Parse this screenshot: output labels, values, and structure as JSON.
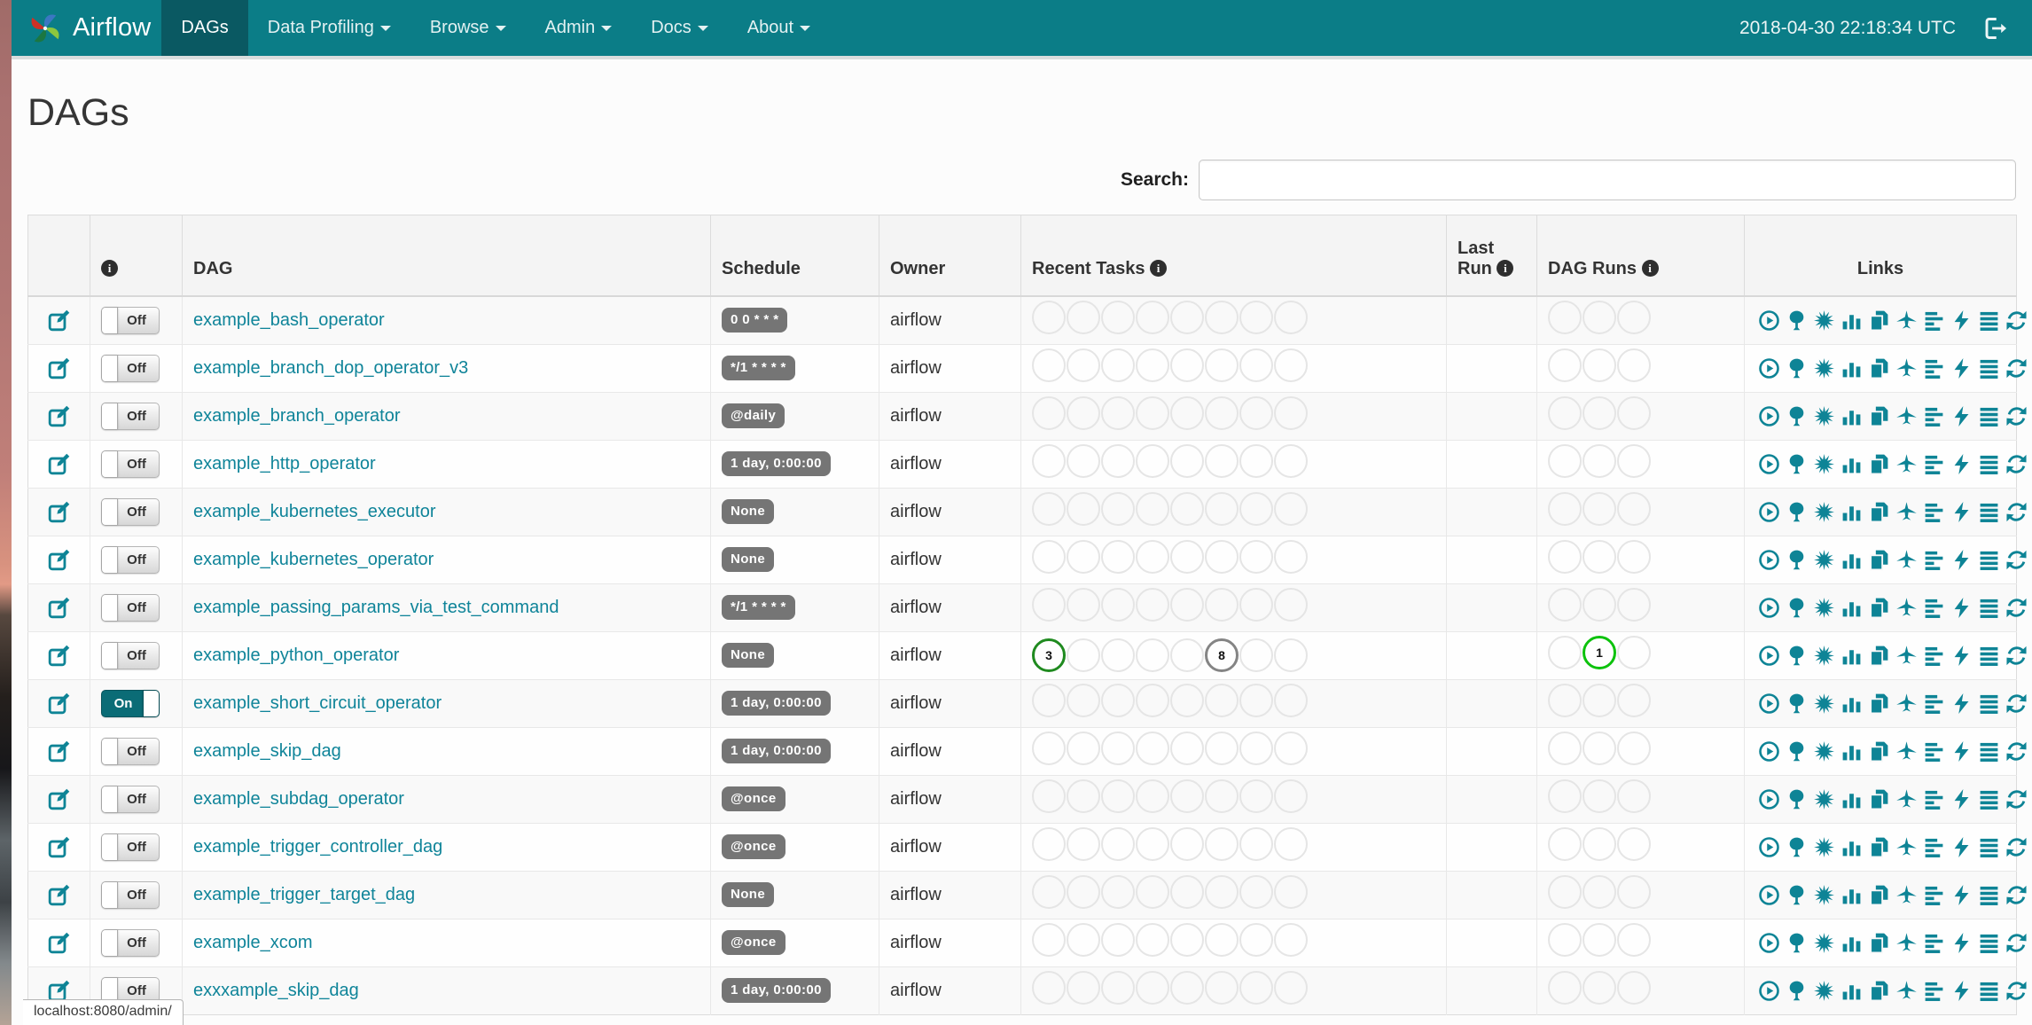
{
  "colors": {
    "navbar_bg": "#0b7d87",
    "navbar_active_bg": "#0a5962",
    "link": "#0f8499",
    "icon_teal": "#0e8496",
    "badge_bg": "#757575",
    "toggle_on_bg": "#0b6c76",
    "state_success": "#1f8a1f",
    "state_running": "#0cc20c",
    "state_queued": "#848484"
  },
  "navbar": {
    "brand": "Airflow",
    "clock": "2018-04-30 22:18:34 UTC",
    "items": [
      {
        "label": "DAGs",
        "active": true,
        "caret": false
      },
      {
        "label": "Data Profiling",
        "active": false,
        "caret": true
      },
      {
        "label": "Browse",
        "active": false,
        "caret": true
      },
      {
        "label": "Admin",
        "active": false,
        "caret": true
      },
      {
        "label": "Docs",
        "active": false,
        "caret": true
      },
      {
        "label": "About",
        "active": false,
        "caret": true
      }
    ]
  },
  "page": {
    "title": "DAGs",
    "search_label": "Search:",
    "status_bar_url": "localhost:8080/admin/"
  },
  "table": {
    "headers": {
      "dag": "DAG",
      "schedule": "Schedule",
      "owner": "Owner",
      "recent_tasks": "Recent Tasks",
      "last_run": "Last Run",
      "dag_runs": "DAG Runs",
      "links": "Links"
    },
    "info_glyph": "i",
    "toggle_on_label": "On",
    "toggle_off_label": "Off",
    "recent_task_states": [
      "success",
      "running",
      "failed",
      "upstream_failed",
      "skipped",
      "up_for_retry",
      "queued",
      "no_status"
    ],
    "dag_run_states": [
      "success",
      "running",
      "failed"
    ],
    "links_icons": [
      "trigger-dag-icon",
      "tree-view-icon",
      "graph-view-icon",
      "task-duration-icon",
      "task-tries-icon",
      "landing-times-icon",
      "gantt-view-icon",
      "code-view-icon",
      "log-view-icon",
      "refresh-icon"
    ],
    "rows": [
      {
        "dag_id": "example_bash_operator",
        "paused": true,
        "schedule": "0 0 * * *",
        "owner": "airflow",
        "recent_tasks": [],
        "dag_runs": []
      },
      {
        "dag_id": "example_branch_dop_operator_v3",
        "paused": true,
        "schedule": "*/1 * * * *",
        "owner": "airflow",
        "recent_tasks": [],
        "dag_runs": []
      },
      {
        "dag_id": "example_branch_operator",
        "paused": true,
        "schedule": "@daily",
        "owner": "airflow",
        "recent_tasks": [],
        "dag_runs": []
      },
      {
        "dag_id": "example_http_operator",
        "paused": true,
        "schedule": "1 day, 0:00:00",
        "owner": "airflow",
        "recent_tasks": [],
        "dag_runs": []
      },
      {
        "dag_id": "example_kubernetes_executor",
        "paused": true,
        "schedule": "None",
        "owner": "airflow",
        "recent_tasks": [],
        "dag_runs": []
      },
      {
        "dag_id": "example_kubernetes_operator",
        "paused": true,
        "schedule": "None",
        "owner": "airflow",
        "recent_tasks": [],
        "dag_runs": []
      },
      {
        "dag_id": "example_passing_params_via_test_command",
        "paused": true,
        "schedule": "*/1 * * * *",
        "owner": "airflow",
        "recent_tasks": [],
        "dag_runs": []
      },
      {
        "dag_id": "example_python_operator",
        "paused": true,
        "schedule": "None",
        "owner": "airflow",
        "recent_tasks": [
          {
            "slot": 0,
            "state": "success",
            "count": 3
          },
          {
            "slot": 5,
            "state": "queued",
            "count": 8
          }
        ],
        "dag_runs": [
          {
            "slot": 1,
            "state": "running",
            "count": 1
          }
        ]
      },
      {
        "dag_id": "example_short_circuit_operator",
        "paused": false,
        "schedule": "1 day, 0:00:00",
        "owner": "airflow",
        "recent_tasks": [],
        "dag_runs": []
      },
      {
        "dag_id": "example_skip_dag",
        "paused": true,
        "schedule": "1 day, 0:00:00",
        "owner": "airflow",
        "recent_tasks": [],
        "dag_runs": []
      },
      {
        "dag_id": "example_subdag_operator",
        "paused": true,
        "schedule": "@once",
        "owner": "airflow",
        "recent_tasks": [],
        "dag_runs": []
      },
      {
        "dag_id": "example_trigger_controller_dag",
        "paused": true,
        "schedule": "@once",
        "owner": "airflow",
        "recent_tasks": [],
        "dag_runs": []
      },
      {
        "dag_id": "example_trigger_target_dag",
        "paused": true,
        "schedule": "None",
        "owner": "airflow",
        "recent_tasks": [],
        "dag_runs": []
      },
      {
        "dag_id": "example_xcom",
        "paused": true,
        "schedule": "@once",
        "owner": "airflow",
        "recent_tasks": [],
        "dag_runs": []
      },
      {
        "dag_id": "exxxample_skip_dag",
        "paused": true,
        "schedule": "1 day, 0:00:00",
        "owner": "airflow",
        "recent_tasks": [],
        "dag_runs": []
      }
    ]
  }
}
